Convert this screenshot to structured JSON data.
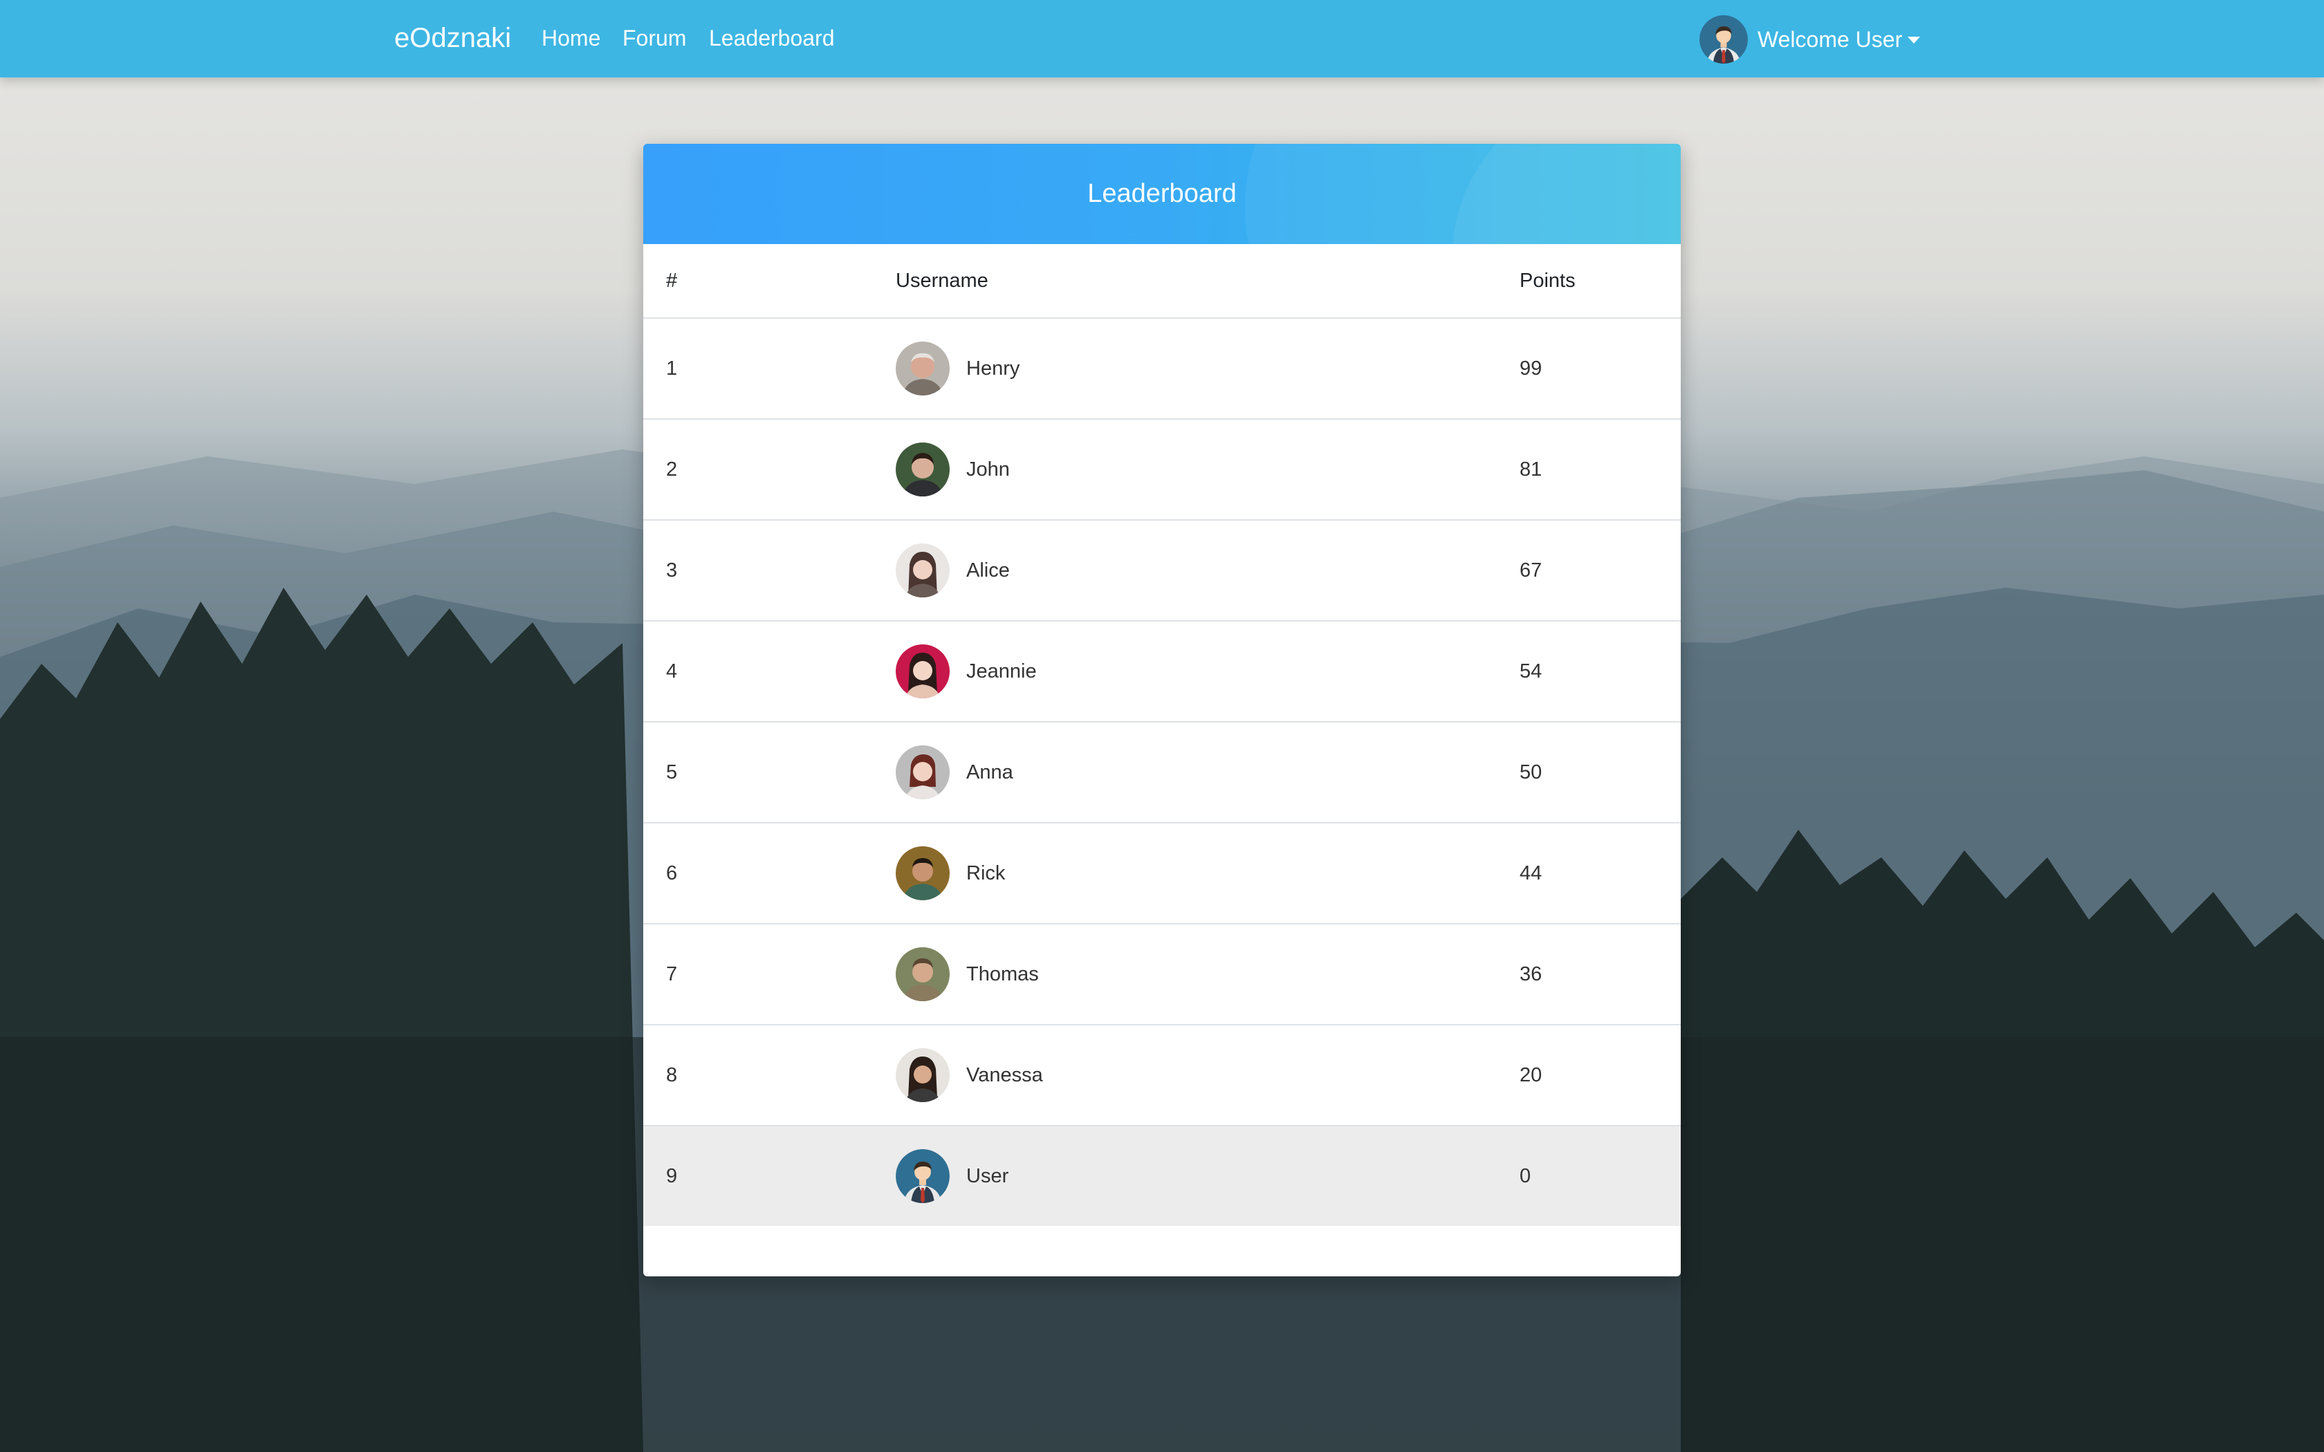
{
  "navbar": {
    "brand": "eOdznaki",
    "links": [
      "Home",
      "Forum",
      "Leaderboard"
    ],
    "user_menu": {
      "label": "Welcome User",
      "avatar": "user-avatar-icon"
    }
  },
  "leaderboard": {
    "title": "Leaderboard",
    "columns": [
      "#",
      "Username",
      "Points"
    ],
    "rows": [
      {
        "rank": "1",
        "username": "Henry",
        "points": "99"
      },
      {
        "rank": "2",
        "username": "John",
        "points": "81"
      },
      {
        "rank": "3",
        "username": "Alice",
        "points": "67"
      },
      {
        "rank": "4",
        "username": "Jeannie",
        "points": "54"
      },
      {
        "rank": "5",
        "username": "Anna",
        "points": "50"
      },
      {
        "rank": "6",
        "username": "Rick",
        "points": "44"
      },
      {
        "rank": "7",
        "username": "Thomas",
        "points": "36"
      },
      {
        "rank": "8",
        "username": "Vanessa",
        "points": "20"
      },
      {
        "rank": "9",
        "username": "User",
        "points": "0"
      }
    ],
    "highlighted_row": "User"
  },
  "colors": {
    "navbar": "#3db6e4",
    "header_gradient_start": "#37a0fb",
    "header_gradient_end": "#39bfe3",
    "highlight_row": "#ececec"
  }
}
